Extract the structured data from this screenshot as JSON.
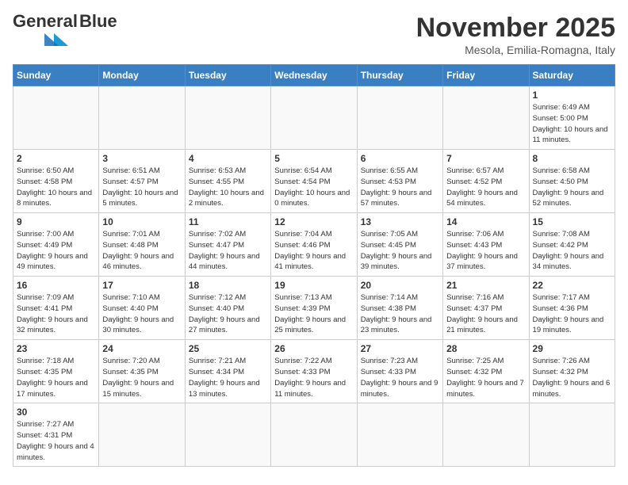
{
  "logo": {
    "text_general": "General",
    "text_blue": "Blue"
  },
  "header": {
    "month": "November 2025",
    "location": "Mesola, Emilia-Romagna, Italy"
  },
  "weekdays": [
    "Sunday",
    "Monday",
    "Tuesday",
    "Wednesday",
    "Thursday",
    "Friday",
    "Saturday"
  ],
  "weeks": [
    [
      {
        "day": "",
        "info": ""
      },
      {
        "day": "",
        "info": ""
      },
      {
        "day": "",
        "info": ""
      },
      {
        "day": "",
        "info": ""
      },
      {
        "day": "",
        "info": ""
      },
      {
        "day": "",
        "info": ""
      },
      {
        "day": "1",
        "info": "Sunrise: 6:49 AM\nSunset: 5:00 PM\nDaylight: 10 hours and 11 minutes."
      }
    ],
    [
      {
        "day": "2",
        "info": "Sunrise: 6:50 AM\nSunset: 4:58 PM\nDaylight: 10 hours and 8 minutes."
      },
      {
        "day": "3",
        "info": "Sunrise: 6:51 AM\nSunset: 4:57 PM\nDaylight: 10 hours and 5 minutes."
      },
      {
        "day": "4",
        "info": "Sunrise: 6:53 AM\nSunset: 4:55 PM\nDaylight: 10 hours and 2 minutes."
      },
      {
        "day": "5",
        "info": "Sunrise: 6:54 AM\nSunset: 4:54 PM\nDaylight: 10 hours and 0 minutes."
      },
      {
        "day": "6",
        "info": "Sunrise: 6:55 AM\nSunset: 4:53 PM\nDaylight: 9 hours and 57 minutes."
      },
      {
        "day": "7",
        "info": "Sunrise: 6:57 AM\nSunset: 4:52 PM\nDaylight: 9 hours and 54 minutes."
      },
      {
        "day": "8",
        "info": "Sunrise: 6:58 AM\nSunset: 4:50 PM\nDaylight: 9 hours and 52 minutes."
      }
    ],
    [
      {
        "day": "9",
        "info": "Sunrise: 7:00 AM\nSunset: 4:49 PM\nDaylight: 9 hours and 49 minutes."
      },
      {
        "day": "10",
        "info": "Sunrise: 7:01 AM\nSunset: 4:48 PM\nDaylight: 9 hours and 46 minutes."
      },
      {
        "day": "11",
        "info": "Sunrise: 7:02 AM\nSunset: 4:47 PM\nDaylight: 9 hours and 44 minutes."
      },
      {
        "day": "12",
        "info": "Sunrise: 7:04 AM\nSunset: 4:46 PM\nDaylight: 9 hours and 41 minutes."
      },
      {
        "day": "13",
        "info": "Sunrise: 7:05 AM\nSunset: 4:45 PM\nDaylight: 9 hours and 39 minutes."
      },
      {
        "day": "14",
        "info": "Sunrise: 7:06 AM\nSunset: 4:43 PM\nDaylight: 9 hours and 37 minutes."
      },
      {
        "day": "15",
        "info": "Sunrise: 7:08 AM\nSunset: 4:42 PM\nDaylight: 9 hours and 34 minutes."
      }
    ],
    [
      {
        "day": "16",
        "info": "Sunrise: 7:09 AM\nSunset: 4:41 PM\nDaylight: 9 hours and 32 minutes."
      },
      {
        "day": "17",
        "info": "Sunrise: 7:10 AM\nSunset: 4:40 PM\nDaylight: 9 hours and 30 minutes."
      },
      {
        "day": "18",
        "info": "Sunrise: 7:12 AM\nSunset: 4:40 PM\nDaylight: 9 hours and 27 minutes."
      },
      {
        "day": "19",
        "info": "Sunrise: 7:13 AM\nSunset: 4:39 PM\nDaylight: 9 hours and 25 minutes."
      },
      {
        "day": "20",
        "info": "Sunrise: 7:14 AM\nSunset: 4:38 PM\nDaylight: 9 hours and 23 minutes."
      },
      {
        "day": "21",
        "info": "Sunrise: 7:16 AM\nSunset: 4:37 PM\nDaylight: 9 hours and 21 minutes."
      },
      {
        "day": "22",
        "info": "Sunrise: 7:17 AM\nSunset: 4:36 PM\nDaylight: 9 hours and 19 minutes."
      }
    ],
    [
      {
        "day": "23",
        "info": "Sunrise: 7:18 AM\nSunset: 4:35 PM\nDaylight: 9 hours and 17 minutes."
      },
      {
        "day": "24",
        "info": "Sunrise: 7:20 AM\nSunset: 4:35 PM\nDaylight: 9 hours and 15 minutes."
      },
      {
        "day": "25",
        "info": "Sunrise: 7:21 AM\nSunset: 4:34 PM\nDaylight: 9 hours and 13 minutes."
      },
      {
        "day": "26",
        "info": "Sunrise: 7:22 AM\nSunset: 4:33 PM\nDaylight: 9 hours and 11 minutes."
      },
      {
        "day": "27",
        "info": "Sunrise: 7:23 AM\nSunset: 4:33 PM\nDaylight: 9 hours and 9 minutes."
      },
      {
        "day": "28",
        "info": "Sunrise: 7:25 AM\nSunset: 4:32 PM\nDaylight: 9 hours and 7 minutes."
      },
      {
        "day": "29",
        "info": "Sunrise: 7:26 AM\nSunset: 4:32 PM\nDaylight: 9 hours and 6 minutes."
      }
    ],
    [
      {
        "day": "30",
        "info": "Sunrise: 7:27 AM\nSunset: 4:31 PM\nDaylight: 9 hours and 4 minutes."
      },
      {
        "day": "",
        "info": ""
      },
      {
        "day": "",
        "info": ""
      },
      {
        "day": "",
        "info": ""
      },
      {
        "day": "",
        "info": ""
      },
      {
        "day": "",
        "info": ""
      },
      {
        "day": "",
        "info": ""
      }
    ]
  ]
}
